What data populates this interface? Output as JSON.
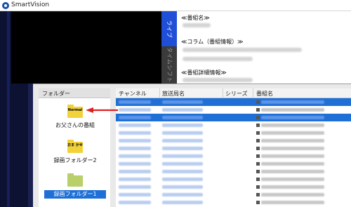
{
  "window": {
    "title": "SmartVision"
  },
  "side_tabs": [
    {
      "label": "ライブ",
      "active": true
    },
    {
      "label": "タイムシフト",
      "active": false
    }
  ],
  "program_info": {
    "name_label": "≪番組名≫",
    "column_label": "≪コラム（番組情報）≫",
    "detail_label": "≪番組詳細情報≫"
  },
  "folders": {
    "header": "フォルダー",
    "items": [
      {
        "label": "お父さんの番組",
        "icon": "folder-icon",
        "tag": "Normal",
        "color": "#f2d23a",
        "selected": false
      },
      {
        "label": "録画フォルダー2",
        "icon": "folder-icon",
        "tag": "おま かせ",
        "color": "#f2d23a",
        "selected": false
      },
      {
        "label": "録画フォルダー1",
        "icon": "folder-icon",
        "tag": "",
        "color": "#b8cf6a",
        "selected": true
      }
    ]
  },
  "list": {
    "columns": [
      "チャンネル",
      "放送局名",
      "シリーズ",
      "番組名"
    ],
    "selected_rows": [
      0,
      2
    ]
  },
  "colors": {
    "accent": "#1e6fd6",
    "live_tab": "#1e4fd6",
    "annotation_arrow": "#e02020"
  }
}
